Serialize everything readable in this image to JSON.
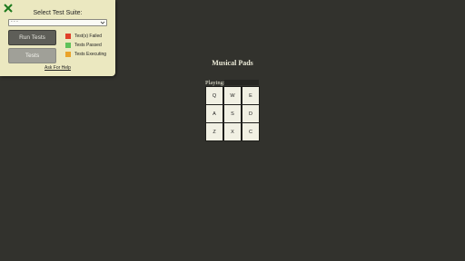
{
  "test_panel": {
    "close_icon": "close-icon",
    "close_color": "#1d7a1d",
    "title": "Select Test Suite:",
    "suite_select": {
      "value": "- - -"
    },
    "run_button": "Run Tests",
    "tests_button": "Tests",
    "legend": [
      {
        "label": "Test(s) Failed",
        "color": "#e0402a"
      },
      {
        "label": "Tests Passed",
        "color": "#5fc25a"
      },
      {
        "label": "Tests Executing",
        "color": "#eaa32a"
      }
    ],
    "help_link": "Ask For Help"
  },
  "app": {
    "title": "Musical Pads",
    "playing_label": "Playing:",
    "pads": [
      {
        "key": "Q"
      },
      {
        "key": "W"
      },
      {
        "key": "E"
      },
      {
        "key": "A"
      },
      {
        "key": "S"
      },
      {
        "key": "D"
      },
      {
        "key": "Z"
      },
      {
        "key": "X"
      },
      {
        "key": "C"
      }
    ]
  }
}
